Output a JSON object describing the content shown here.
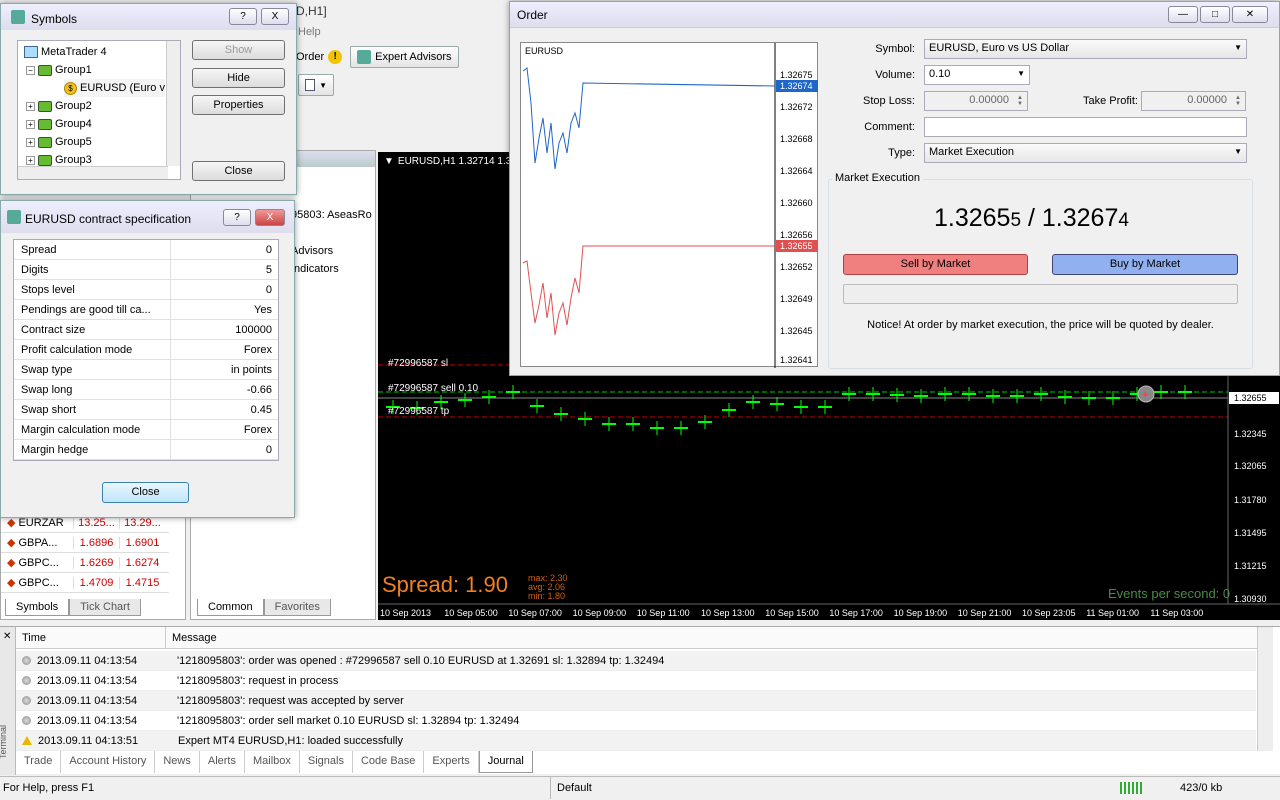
{
  "main": {
    "title_fragment": "D,H1]",
    "help_menu": "Help",
    "toolbar": {
      "order_label": "Order",
      "expert_advisors": "Expert Advisors"
    }
  },
  "navigator": {
    "account_text": "95803: AseasRo",
    "items": [
      "Advisors",
      "Indicators"
    ],
    "tabs": [
      "Common",
      "Favorites"
    ]
  },
  "market_watch": {
    "rows": [
      {
        "symbol": "EURZAR",
        "bid": "13.25...",
        "ask": "13.29..."
      },
      {
        "symbol": "GBPA...",
        "bid": "1.6896",
        "ask": "1.6901"
      },
      {
        "symbol": "GBPC...",
        "bid": "1.6269",
        "ask": "1.6274"
      },
      {
        "symbol": "GBPC...",
        "bid": "1.4709",
        "ask": "1.4715"
      }
    ],
    "tabs": [
      "Symbols",
      "Tick Chart"
    ]
  },
  "symbols_dialog": {
    "title": "Symbols",
    "tree": [
      {
        "label": "MetaTrader 4",
        "level": 0
      },
      {
        "label": "Group1",
        "level": 1
      },
      {
        "label": "EURUSD  (Euro v",
        "level": 2
      },
      {
        "label": "Group2",
        "level": 1
      },
      {
        "label": "Group4",
        "level": 1
      },
      {
        "label": "Group5",
        "level": 1
      },
      {
        "label": "Group3",
        "level": 1
      }
    ],
    "buttons": {
      "show": "Show",
      "hide": "Hide",
      "properties": "Properties",
      "close": "Close"
    },
    "help_btn": "?",
    "close_btn": "X"
  },
  "spec_dialog": {
    "title": "EURUSD contract specification",
    "rows": [
      {
        "k": "Spread",
        "v": "0"
      },
      {
        "k": "Digits",
        "v": "5"
      },
      {
        "k": "Stops level",
        "v": "0"
      },
      {
        "k": "Pendings are good till ca...",
        "v": "Yes"
      },
      {
        "k": "Contract size",
        "v": "100000"
      },
      {
        "k": "Profit calculation mode",
        "v": "Forex"
      },
      {
        "k": "Swap type",
        "v": "in points"
      },
      {
        "k": "Swap long",
        "v": "-0.66"
      },
      {
        "k": "Swap short",
        "v": "0.45"
      },
      {
        "k": "Margin calculation mode",
        "v": "Forex"
      },
      {
        "k": "Margin hedge",
        "v": "0"
      }
    ],
    "close": "Close"
  },
  "chart": {
    "title": "EURUSD,H1  1.32714 1.32",
    "order_labels": [
      "#72996587 sl",
      "#72996587 sell 0.10",
      "#72996587 tp"
    ],
    "prices": [
      "1.32655",
      "1.32345",
      "1.32065",
      "1.31780",
      "1.31495",
      "1.31215",
      "1.30930"
    ],
    "times": [
      "10 Sep 2013",
      "10 Sep 05:00",
      "10 Sep 07:00",
      "10 Sep 09:00",
      "10 Sep 11:00",
      "10 Sep 13:00",
      "10 Sep 15:00",
      "10 Sep 17:00",
      "10 Sep 19:00",
      "10 Sep 21:00",
      "10 Sep 23:05",
      "11 Sep 01:00",
      "11 Sep 03:00"
    ],
    "spread": "Spread: 1.90",
    "spread_stats": {
      "max": "max: 2.30",
      "avg": "avg: 2.06",
      "min": "min: 1.80"
    },
    "events": "Events per second: 0",
    "colors": {
      "bg": "#000000",
      "candle": "#00ff00",
      "sl_line": "#ff0000",
      "price_line": "#888888"
    }
  },
  "order_dialog": {
    "title": "Order",
    "mini_chart": {
      "symbol": "EURUSD",
      "prices": [
        "1.32675",
        "1.32674",
        "1.32672",
        "1.32668",
        "1.32664",
        "1.32660",
        "1.32656",
        "1.32655",
        "1.32652",
        "1.32649",
        "1.32645",
        "1.32641"
      ],
      "ask_color": "#1e66c8",
      "bid_color": "#e05050"
    },
    "labels": {
      "symbol": "Symbol:",
      "volume": "Volume:",
      "stop_loss": "Stop Loss:",
      "take_profit": "Take Profit:",
      "comment": "Comment:",
      "type": "Type:"
    },
    "values": {
      "symbol": "EURUSD, Euro vs US Dollar",
      "volume": "0.10",
      "stop_loss": "0.00000",
      "take_profit": "0.00000",
      "comment": "",
      "type": "Market Execution"
    },
    "group_title": "Market Execution",
    "quote": {
      "bid_main": "1.3265",
      "bid_small": "5",
      "sep": " / ",
      "ask_main": "1.3267",
      "ask_small": "4"
    },
    "sell": "Sell by Market",
    "buy": "Buy by Market",
    "notice": "Notice! At order by market execution, the price will be quoted by dealer."
  },
  "terminal": {
    "side_label": "Terminal",
    "columns": [
      "Time",
      "Message"
    ],
    "rows": [
      {
        "time": "2013.09.11 04:13:54",
        "msg": "'1218095803': order was opened : #72996587 sell 0.10 EURUSD at 1.32691 sl: 1.32894 tp: 1.32494",
        "icon": "info"
      },
      {
        "time": "2013.09.11 04:13:54",
        "msg": "'1218095803': request in process",
        "icon": "info"
      },
      {
        "time": "2013.09.11 04:13:54",
        "msg": "'1218095803': request was accepted by server",
        "icon": "info"
      },
      {
        "time": "2013.09.11 04:13:54",
        "msg": "'1218095803': order sell market 0.10 EURUSD sl: 1.32894 tp: 1.32494",
        "icon": "info"
      },
      {
        "time": "2013.09.11 04:13:51",
        "msg": "Expert MT4 EURUSD,H1: loaded successfully",
        "icon": "warning"
      }
    ],
    "tabs": [
      "Trade",
      "Account History",
      "News",
      "Alerts",
      "Mailbox",
      "Signals",
      "Code Base",
      "Experts",
      "Journal"
    ],
    "active_tab": "Journal"
  },
  "status": {
    "help": "For Help, press F1",
    "profile": "Default",
    "traffic": "423/0 kb"
  }
}
